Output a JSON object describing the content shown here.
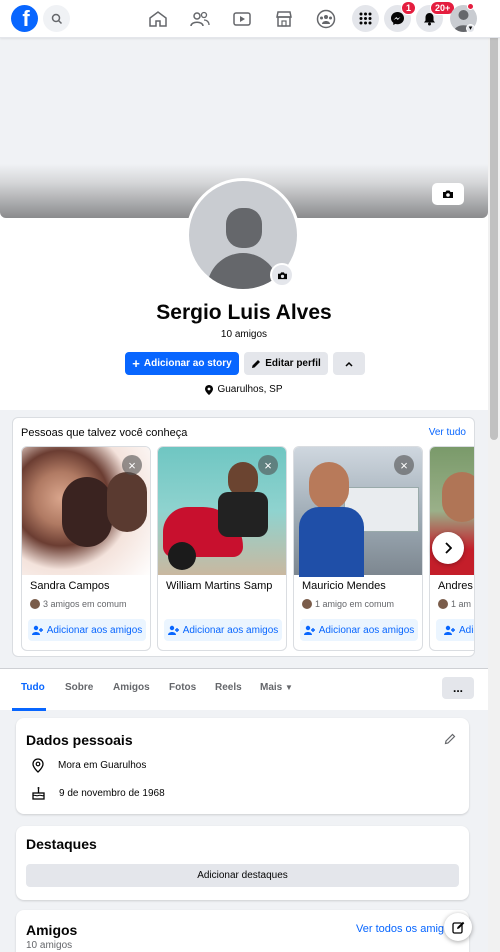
{
  "nav": {
    "logo_letter": "f",
    "messenger_badge": "1",
    "notifications_badge": "20+"
  },
  "profile": {
    "name": "Sergio Luis Alves",
    "friends_count": "10 amigos",
    "add_story_label": "Adicionar ao story",
    "edit_profile_label": "Editar perfil",
    "location": "Guarulhos, SP"
  },
  "pymk": {
    "title": "Pessoas que talvez você conheça",
    "see_all": "Ver tudo",
    "add_label": "Adicionar aos amigos",
    "people": [
      {
        "name": "Sandra Campos",
        "mutual": "3 amigos em comum"
      },
      {
        "name": "William Martins Samp",
        "mutual": ""
      },
      {
        "name": "Mauricio Mendes",
        "mutual": "1 amigo em comum"
      },
      {
        "name": "Andres",
        "mutual": "1 am"
      }
    ],
    "partial_add_label": "Adic"
  },
  "tabs": {
    "items": [
      "Tudo",
      "Sobre",
      "Amigos",
      "Fotos",
      "Reels",
      "Mais"
    ],
    "more_dots": "..."
  },
  "personal": {
    "title": "Dados pessoais",
    "lives_in": "Mora em Guarulhos",
    "birthday": "9 de novembro de 1968"
  },
  "highlights": {
    "title": "Destaques",
    "add_label": "Adicionar destaques"
  },
  "friends": {
    "title": "Amigos",
    "count": "10 amigos",
    "see_all": "Ver todos os amig"
  },
  "colors": {
    "brand": "#0866ff",
    "badge": "#e41e3f",
    "background": "#f0f2f5"
  }
}
